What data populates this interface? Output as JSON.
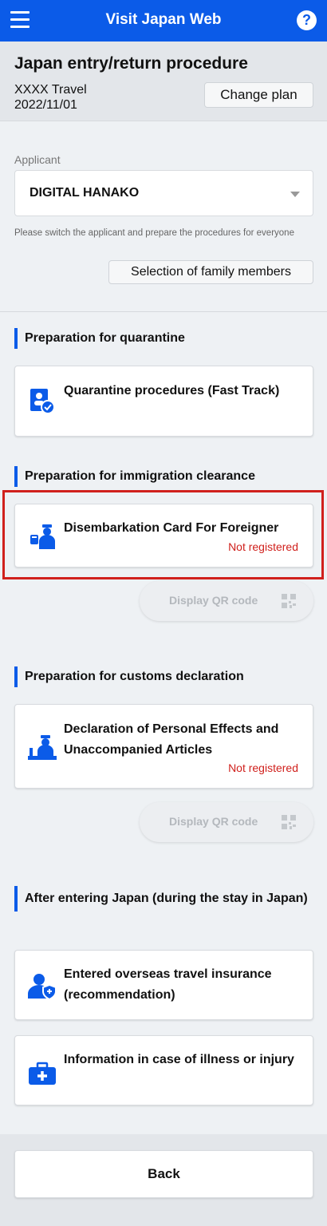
{
  "header": {
    "title": "Visit Japan Web",
    "menu_icon": "menu-icon",
    "help_icon": "help-icon",
    "help_glyph": "?",
    "color": "#0b5be8"
  },
  "plan": {
    "title": "Japan entry/return procedure",
    "name": "XXXX Travel",
    "date": "2022/11/01",
    "change_label": "Change plan"
  },
  "applicant": {
    "label": "Applicant",
    "selected": "DIGITAL HANAKO",
    "note": "Please switch the applicant and prepare the procedures for everyone",
    "family_label": "Selection of family members"
  },
  "sections": {
    "quarantine": {
      "heading": "Preparation for quarantine",
      "card_title": "Quarantine procedures (Fast Track)",
      "icon": "quarantine-document-icon"
    },
    "immigration": {
      "heading": "Preparation for immigration clearance",
      "card_title": "Disembarkation Card For Foreigner",
      "status": "Not registered",
      "qr_label": "Display QR code",
      "icon": "immigration-officer-icon"
    },
    "customs": {
      "heading": "Preparation for customs declaration",
      "card_title": "Declaration of Personal Effects and Unaccompanied Articles",
      "status": "Not registered",
      "qr_label": "Display QR code",
      "icon": "customs-officer-icon"
    },
    "after_entry": {
      "heading": "After entering Japan (during the stay in Japan)",
      "insurance_title": "Entered overseas travel insurance (recommendation)",
      "insurance_icon": "user-shield-icon",
      "illness_title": "Information in case of illness or injury",
      "illness_icon": "medical-kit-icon"
    }
  },
  "footer": {
    "back_label": "Back"
  },
  "colors": {
    "accent": "#0b5be8",
    "status_red": "#d0201c",
    "highlight": "#d0201c"
  }
}
